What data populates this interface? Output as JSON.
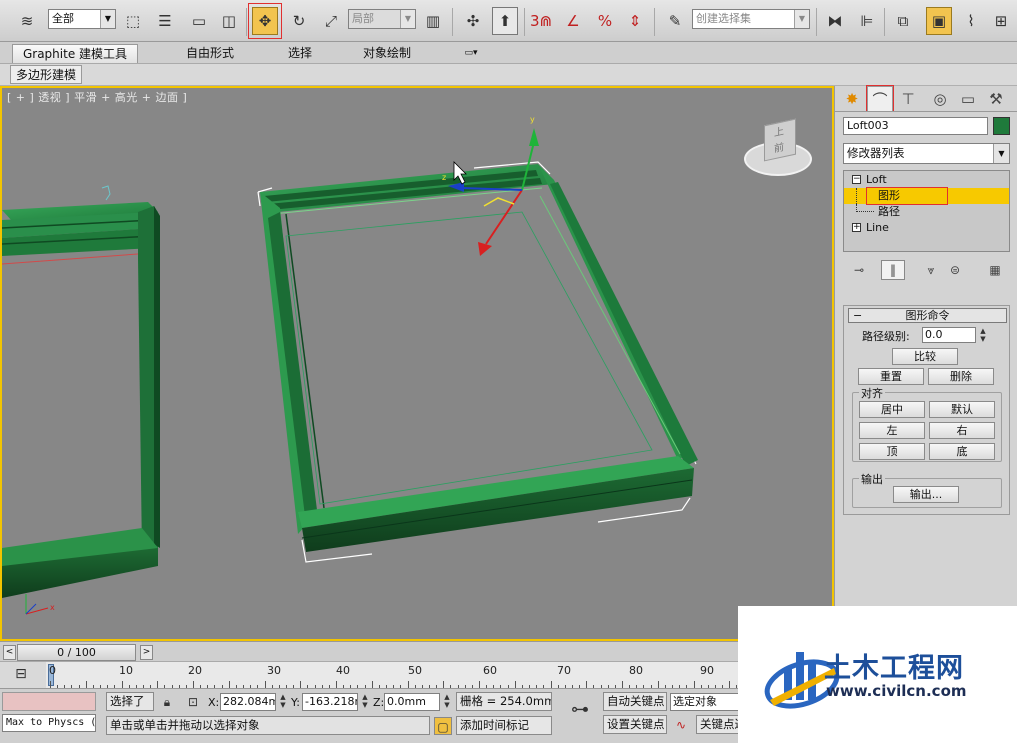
{
  "toolbar": {
    "selection_filter": "全部",
    "ref_coord": "局部",
    "named_selection_placeholder": "创建选择集",
    "snap_label": "3",
    "percent_label": "%"
  },
  "ribbon": {
    "tabs": [
      "Graphite 建模工具",
      "自由形式",
      "选择",
      "对象绘制"
    ],
    "subtab": "多边形建模"
  },
  "viewport": {
    "label": "[ + ] 透视 ] 平滑 + 高光 + 边面 ]",
    "viewcube_top": "上",
    "viewcube_front": "前"
  },
  "command_panel": {
    "object_name": "Loft003",
    "object_color": "#1f7a3b",
    "modifier_list": "修改器列表",
    "stack": [
      {
        "label": "Loft",
        "expander": "−"
      },
      {
        "label": "图形",
        "selected": true
      },
      {
        "label": "路径"
      },
      {
        "label": "Line",
        "expander": "+"
      }
    ],
    "rollout_title": "图形命令",
    "rollout_collapse": "−",
    "path_level_label": "路径级别:",
    "path_level_value": "0.0",
    "compare_btn": "比较",
    "reset_btn": "重置",
    "delete_btn": "删除",
    "align_group": "对齐",
    "align_buttons": [
      "居中",
      "默认",
      "左",
      "右",
      "顶",
      "底"
    ],
    "output_group": "输出",
    "output_btn": "输出..."
  },
  "timeline": {
    "slider_text": "0 / 100",
    "prev": "<",
    "next": ">",
    "ticks": [
      "0",
      "10",
      "20",
      "30",
      "40",
      "50",
      "60",
      "70",
      "80",
      "90"
    ]
  },
  "status": {
    "maxscript": "Max to Physcs (",
    "selected": "选择了",
    "x_label": "X:",
    "x_value": "282.084mm",
    "y_label": "Y:",
    "y_value": "-163.218mm",
    "z_label": "Z:",
    "z_value": "0.0mm",
    "grid": "栅格 = 254.0mm",
    "prompt": "单击或单击并拖动以选择对象",
    "add_time_tag": "添加时间标记",
    "auto_key": "自动关键点",
    "set_key": "设置关键点",
    "selected_object": "选定对象",
    "key_filter": "关键点过"
  },
  "watermark": {
    "brand": "土木工程网",
    "url": "www.civilcn.com"
  }
}
